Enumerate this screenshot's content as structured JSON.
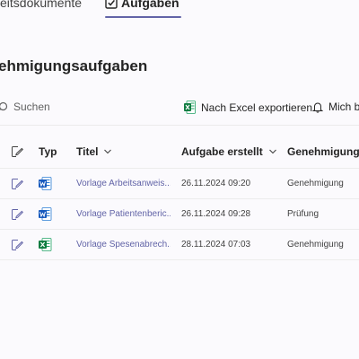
{
  "tabs": {
    "documents_partial": "eitsdokumente",
    "tasks": "Aufgaben"
  },
  "page": {
    "title_partial": "ehmigungsaufgaben"
  },
  "toolbar": {
    "search_placeholder": "Suchen",
    "export_label": "Nach Excel exportieren",
    "follow_partial": "Mich b"
  },
  "table": {
    "headers": {
      "type": "Typ",
      "title": "Titel",
      "created": "Aufgabe erstellt",
      "approval": "Genehmigungs."
    },
    "rows": [
      {
        "file_type": "word",
        "title": "Vorlage Arbeitsanweis...",
        "created": "26.11.2024 09:20",
        "approval": "Genehmigung"
      },
      {
        "file_type": "word",
        "title": "Vorlage Patientenberic...",
        "created": "26.11.2024 09:28",
        "approval": "Prüfung"
      },
      {
        "file_type": "excel",
        "title": "Vorlage Spesenabrech...",
        "created": "28.11.2024 07:03",
        "approval": "Genehmigung"
      }
    ]
  },
  "colors": {
    "accent": "#6264a7",
    "word": "#185abd",
    "excel": "#107c41"
  },
  "icons": [
    "checkbox-icon",
    "search-icon",
    "excel-icon",
    "bell-icon",
    "edit-icon",
    "chevron-down-icon",
    "word-icon"
  ]
}
